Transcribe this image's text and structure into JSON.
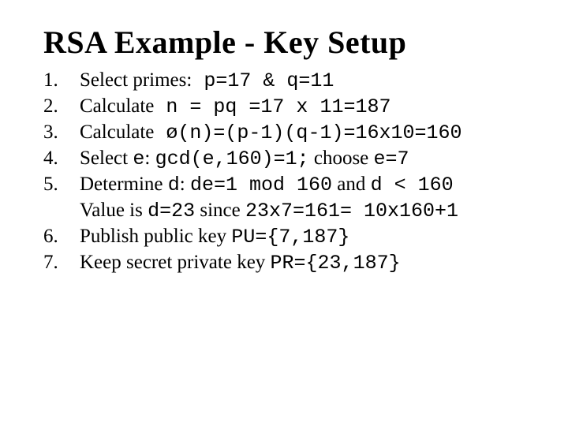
{
  "title": "RSA Example - Key Setup",
  "steps": {
    "s1": {
      "a": "Select primes:",
      "b": " p=17 & q=11"
    },
    "s2": {
      "a": "Calculate",
      "b": "    n = pq =17 x 11=187"
    },
    "s3": {
      "a": "Calculate",
      "b": "    ø(n)=(p-1)(q-1)=16x10=160"
    },
    "s4": {
      "a": "Select ",
      "b": "e",
      "c": ": ",
      "d": "gcd(e,160)=1;",
      "e": " choose ",
      "f": "e=7"
    },
    "s5": {
      "a": "Determine ",
      "b": "d",
      "c": ": ",
      "d": "de=1 mod 160",
      "e": " and ",
      "f": "d < 160",
      "g": "Value is ",
      "h": "d=23",
      "i": " since ",
      "j": "23x7=161= 10x160+1"
    },
    "s6": {
      "a": "Publish public key ",
      "b": "PU={7,187}"
    },
    "s7": {
      "a": "Keep secret private key ",
      "b": "PR={23,187}"
    }
  }
}
